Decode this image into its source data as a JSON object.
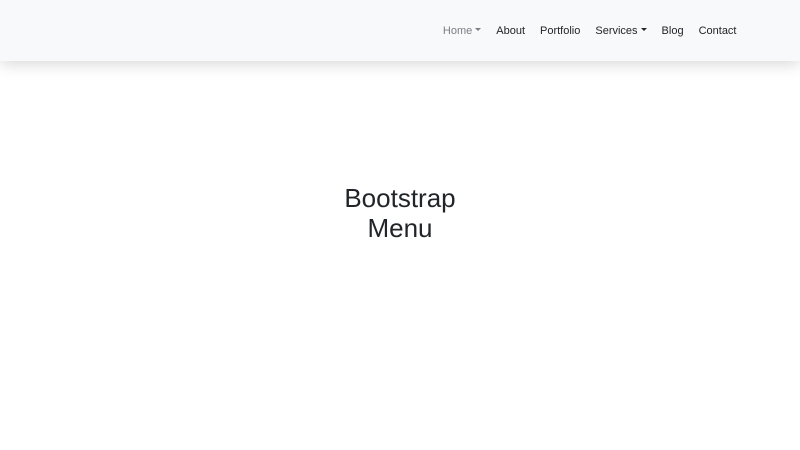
{
  "navbar": {
    "items": [
      {
        "label": "Home",
        "dropdown": true,
        "active": true
      },
      {
        "label": "About",
        "dropdown": false,
        "active": false
      },
      {
        "label": "Portfolio",
        "dropdown": false,
        "active": false
      },
      {
        "label": "Services",
        "dropdown": true,
        "active": false
      },
      {
        "label": "Blog",
        "dropdown": false,
        "active": false
      },
      {
        "label": "Contact",
        "dropdown": false,
        "active": false
      }
    ]
  },
  "hero": {
    "line1": "Bootstrap",
    "line2": "Menu"
  },
  "colors": {
    "navbar_bg": "#f8f9fa",
    "active_link": "#7a7f85",
    "text": "#212529"
  }
}
